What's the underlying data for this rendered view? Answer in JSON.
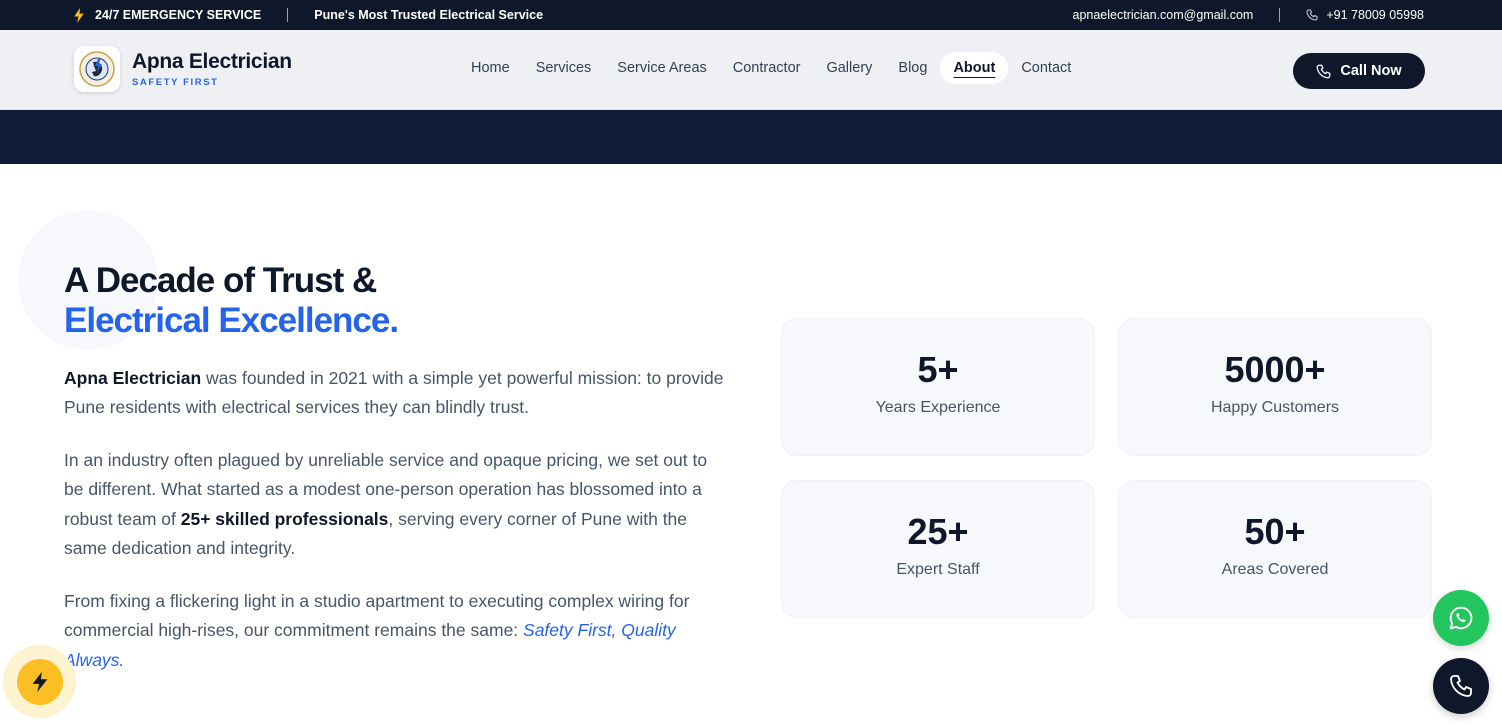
{
  "topbar": {
    "emergency": "24/7 EMERGENCY SERVICE",
    "tagline": "Pune's Most Trusted Electrical Service",
    "email": "apnaelectrician.com@gmail.com",
    "phone": "+91 78009 05998"
  },
  "brand": {
    "name": "Apna Electrician",
    "tagline": "SAFETY FIRST"
  },
  "nav": {
    "items": [
      {
        "label": "Home"
      },
      {
        "label": "Services"
      },
      {
        "label": "Service Areas"
      },
      {
        "label": "Contractor"
      },
      {
        "label": "Gallery"
      },
      {
        "label": "Blog"
      },
      {
        "label": "About",
        "active": true
      },
      {
        "label": "Contact"
      }
    ],
    "cta": "Call Now"
  },
  "about": {
    "headline_line1": "A Decade of Trust &",
    "headline_line2": "Electrical Excellence",
    "headline_dot": ".",
    "p1_strong": "Apna Electrician",
    "p1_rest": " was founded in 2021 with a simple yet powerful mission: to provide Pune residents with electrical services they can blindly trust.",
    "p2_start": "In an industry often plagued by unreliable service and opaque pricing, we set out to be different. What started as a modest one-person operation has blossomed into a robust team of ",
    "p2_strong": "25+ skilled professionals",
    "p2_end": ", serving every corner of Pune with the same dedication and integrity.",
    "p3_start": "From fixing a flickering light in a studio apartment to executing complex wiring for commercial high-rises, our commitment remains the same: ",
    "p3_em": "Safety First, Quality Always."
  },
  "stats": [
    {
      "value": "5+",
      "label": "Years Experience"
    },
    {
      "value": "5000+",
      "label": "Happy Customers"
    },
    {
      "value": "25+",
      "label": "Expert Staff"
    },
    {
      "value": "50+",
      "label": "Areas Covered"
    }
  ],
  "icons": {
    "emergency": "lightning-bolt-icon",
    "phone": "phone-icon",
    "whatsapp": "whatsapp-icon",
    "logo": "apna-electrician-logo"
  },
  "colors": {
    "navy": "#0f172a",
    "accent_blue": "#2563eb",
    "bolt_yellow": "#fbbf24",
    "whatsapp_green": "#22c55e"
  }
}
